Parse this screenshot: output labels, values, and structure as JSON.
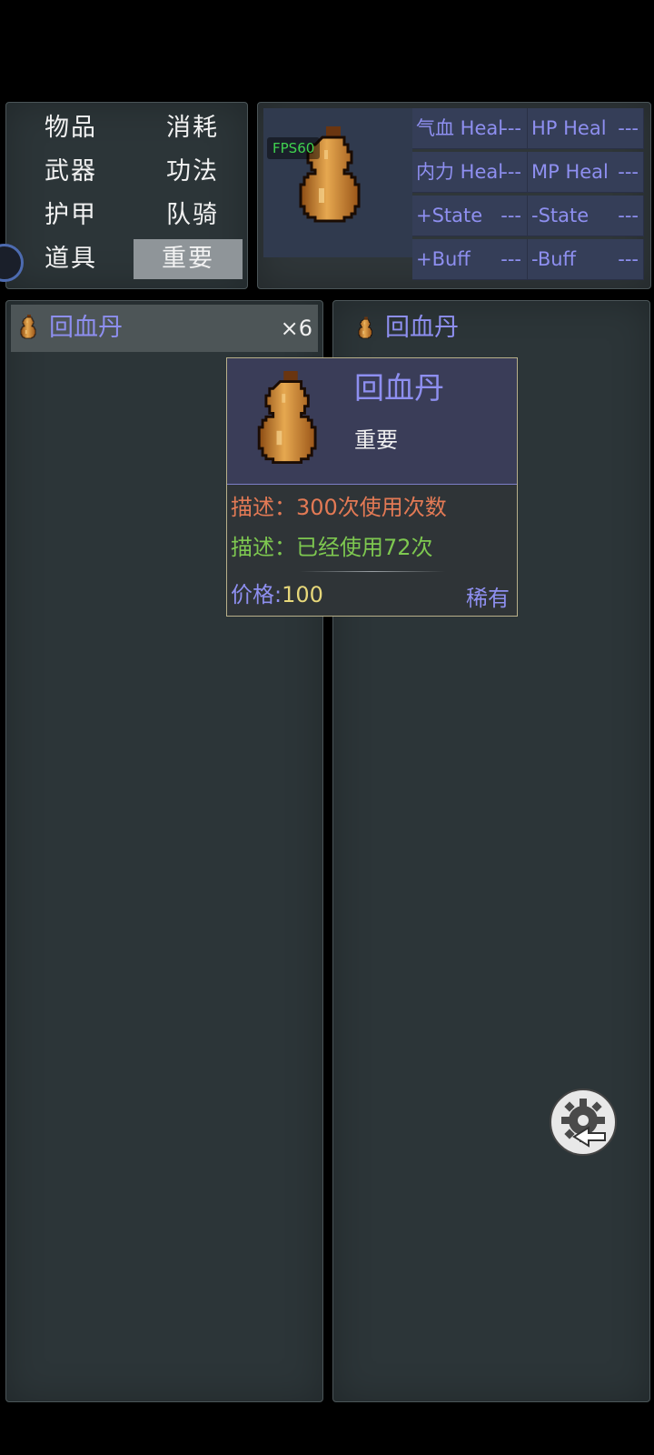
{
  "categories": [
    {
      "label": "物品",
      "active": false
    },
    {
      "label": "消耗",
      "active": false
    },
    {
      "label": "武器",
      "active": false
    },
    {
      "label": "功法",
      "active": false
    },
    {
      "label": "护甲",
      "active": false
    },
    {
      "label": "队骑",
      "active": false
    },
    {
      "label": "道具",
      "active": false
    },
    {
      "label": "重要",
      "active": true
    }
  ],
  "fps_label": "FPS60",
  "stats": [
    {
      "label": "气血 Heal",
      "value": "---"
    },
    {
      "label": "HP Heal",
      "value": "---"
    },
    {
      "label": "内力 Heal",
      "value": "---"
    },
    {
      "label": "MP Heal",
      "value": "---"
    },
    {
      "label": "+State",
      "value": "---"
    },
    {
      "label": "-State",
      "value": "---"
    },
    {
      "label": "+Buff",
      "value": "---"
    },
    {
      "label": "-Buff",
      "value": "---"
    }
  ],
  "inventory": {
    "item_name": "回血丹",
    "quantity": "×6"
  },
  "equip_slot": {
    "item_name": "回血丹"
  },
  "tooltip": {
    "name": "回血丹",
    "type": "重要",
    "desc1": "描述：300次使用次数",
    "desc2": "描述：已经使用72次",
    "price": "价格:100",
    "rarity": "稀有"
  },
  "colors": {
    "panel": "#2c3538",
    "accent_text": "#8e8ff0",
    "desc1": "#e37a55",
    "desc2": "#7ec850",
    "price_value": "#e6d77a",
    "fps": "#3fd24f"
  },
  "icons": {
    "item": "gourd-icon",
    "settings": "gear-back-icon"
  }
}
